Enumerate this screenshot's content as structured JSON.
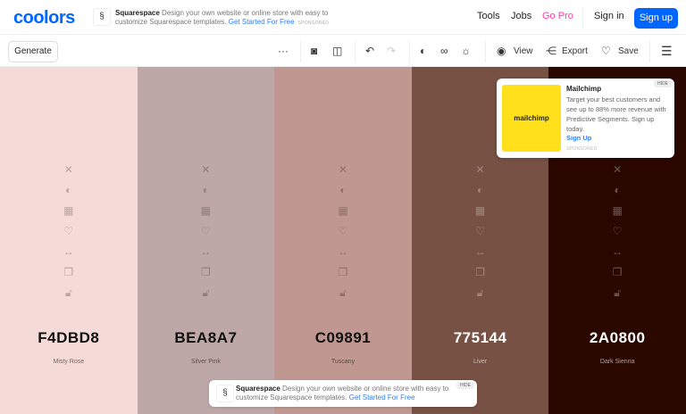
{
  "header": {
    "logo": "coolors",
    "ad": {
      "brand": "Squarespace",
      "text": "Design your own website or online store with easy to customize Squarespace templates.",
      "link": "Get Started For Free",
      "sponsored": "SPONSORED"
    },
    "nav": [
      "Tools",
      "Jobs",
      "Go Pro"
    ],
    "sign_in": "Sign in",
    "sign_up": "Sign up",
    "accent": "#0066ff",
    "pro_color": "#ff3ea5"
  },
  "toolbar": {
    "generate": "Generate",
    "view": "View",
    "export": "Export",
    "save": "Save"
  },
  "palette": [
    {
      "hex": "F4DBD8",
      "name": "Misty Rose",
      "dark_text": true
    },
    {
      "hex": "BEA8A7",
      "name": "Silver Pink",
      "dark_text": true
    },
    {
      "hex": "C09891",
      "name": "Tuscany",
      "dark_text": true
    },
    {
      "hex": "775144",
      "name": "Liver",
      "dark_text": false
    },
    {
      "hex": "2A0800",
      "name": "Dark Sienna",
      "dark_text": false
    }
  ],
  "mailchimp_ad": {
    "hide": "HIDE",
    "logo": "mailchimp",
    "title": "Mailchimp",
    "body": "Target your best customers and see up to 88% more revenue with Predictive Segments. Sign up today.",
    "link": "Sign Up",
    "sponsored": "SPONSORED"
  },
  "bottom_ad": {
    "hide": "HIDE",
    "brand": "Squarespace",
    "text": "Design your own website or online store with easy to customize Squarespace templates.",
    "link": "Get Started For Free"
  }
}
